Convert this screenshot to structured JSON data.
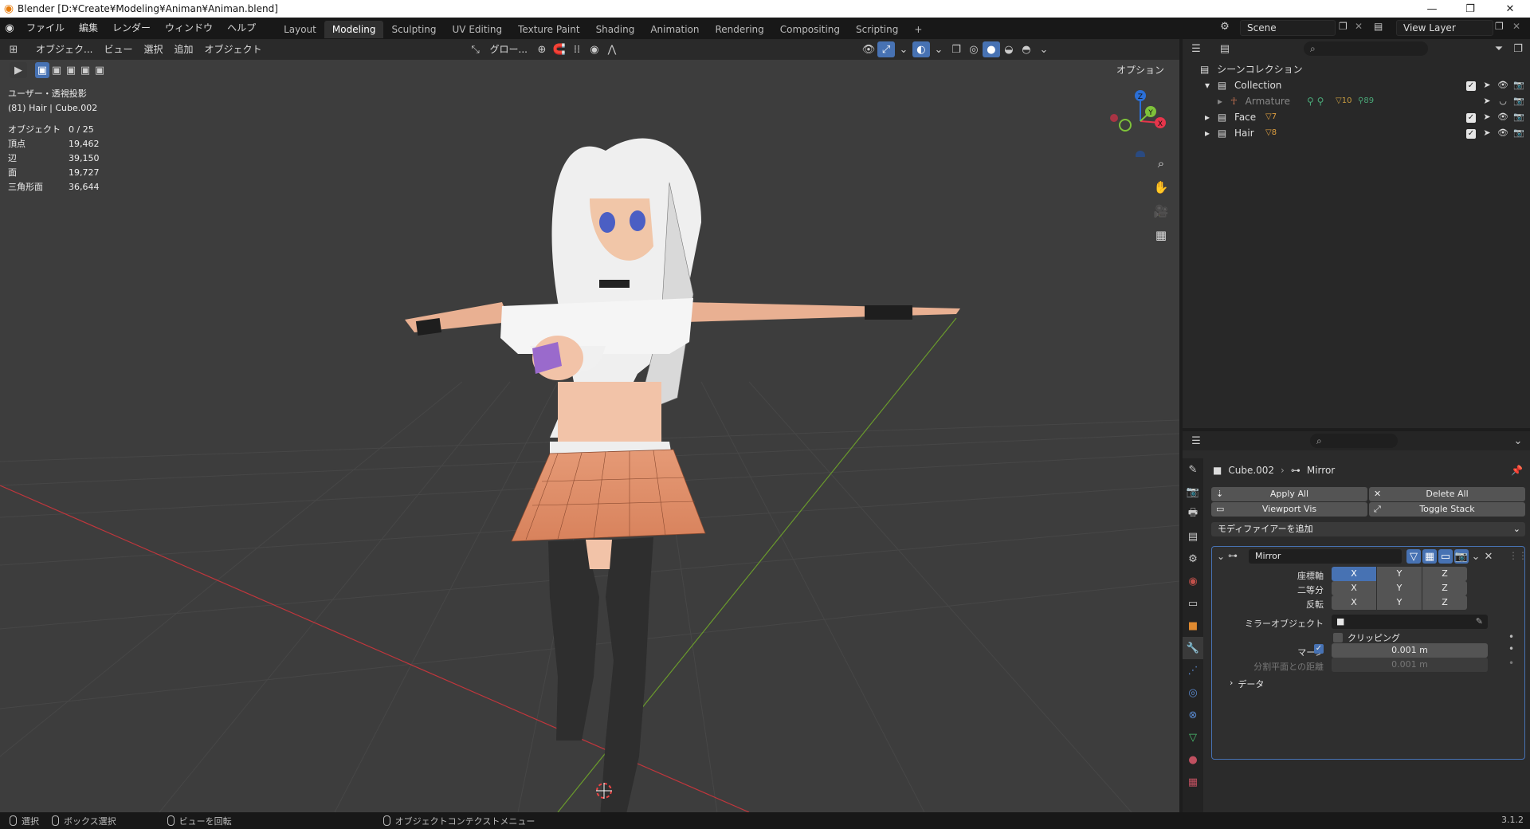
{
  "window": {
    "title": "Blender [D:¥Create¥Modeling¥Animan¥Animan.blend]",
    "minimize": "—",
    "restore": "❐",
    "close": "✕"
  },
  "menubar": {
    "items": [
      "ファイル",
      "編集",
      "レンダー",
      "ウィンドウ",
      "ヘルプ"
    ]
  },
  "workspaces": {
    "tabs": [
      "Layout",
      "Modeling",
      "Sculpting",
      "UV Editing",
      "Texture Paint",
      "Shading",
      "Animation",
      "Rendering",
      "Compositing",
      "Scripting"
    ],
    "active": "Modeling",
    "add": "+"
  },
  "scene": {
    "name": "Scene",
    "view_layer": "View Layer"
  },
  "viewport_header": {
    "mode": "オブジェク...",
    "menus": [
      "ビュー",
      "選択",
      "追加",
      "オブジェクト"
    ],
    "transform": "グロー...",
    "options": "オプション"
  },
  "viewport_info": {
    "view_name": "ユーザー・透視投影",
    "object_info": "(81) Hair | Cube.002"
  },
  "stats": [
    {
      "label": "オブジェクト",
      "value": "0 / 25"
    },
    {
      "label": "頂点",
      "value": "19,462"
    },
    {
      "label": "辺",
      "value": "39,150"
    },
    {
      "label": "面",
      "value": "19,727"
    },
    {
      "label": "三角形面",
      "value": "36,644"
    }
  ],
  "gizmo": {
    "z": "Z",
    "y": "Y",
    "x": "X"
  },
  "outliner": {
    "root": "シーンコレクション",
    "rows": [
      {
        "name": "Collection",
        "level": 1
      },
      {
        "name": "Armature",
        "level": 2,
        "dim": true,
        "badges": [
          "10",
          "89"
        ]
      },
      {
        "name": "Face",
        "level": 1,
        "badge": "7"
      },
      {
        "name": "Hair",
        "level": 1,
        "badge": "8"
      }
    ]
  },
  "properties": {
    "breadcrumb_object": "Cube.002",
    "breadcrumb_modifier": "Mirror",
    "apply_all": "Apply All",
    "delete_all": "Delete All",
    "viewport_vis": "Viewport Vis",
    "toggle_stack": "Toggle Stack",
    "add_modifier": "モディファイアーを追加",
    "modifier_name": "Mirror",
    "axis_label": "座標軸",
    "bisect_label": "二等分",
    "flip_label": "反転",
    "axes": [
      "X",
      "Y",
      "Z"
    ],
    "mirror_object_label": "ミラーオブジェクト",
    "clipping_label": "クリッピング",
    "merge_label": "マージ",
    "merge_value": "0.001 m",
    "bisect_distance_label": "分割平面との距離",
    "bisect_distance_value": "0.001 m",
    "data_label": "データ"
  },
  "statusbar": {
    "select": "選択",
    "box_select": "ボックス選択",
    "rotate_view": "ビューを回転",
    "context_menu": "オブジェクトコンテクストメニュー",
    "version": "3.1.2"
  },
  "colors": {
    "accent": "#4772b3",
    "viewport_bg": "#3d3d3d",
    "axis_x": "#c0363c",
    "axis_y": "#6a9a2c",
    "gizmo_z": "#2b6fd6",
    "gizmo_x": "#e6354b",
    "gizmo_y": "#7ec23a",
    "skirt": "#e39672"
  }
}
